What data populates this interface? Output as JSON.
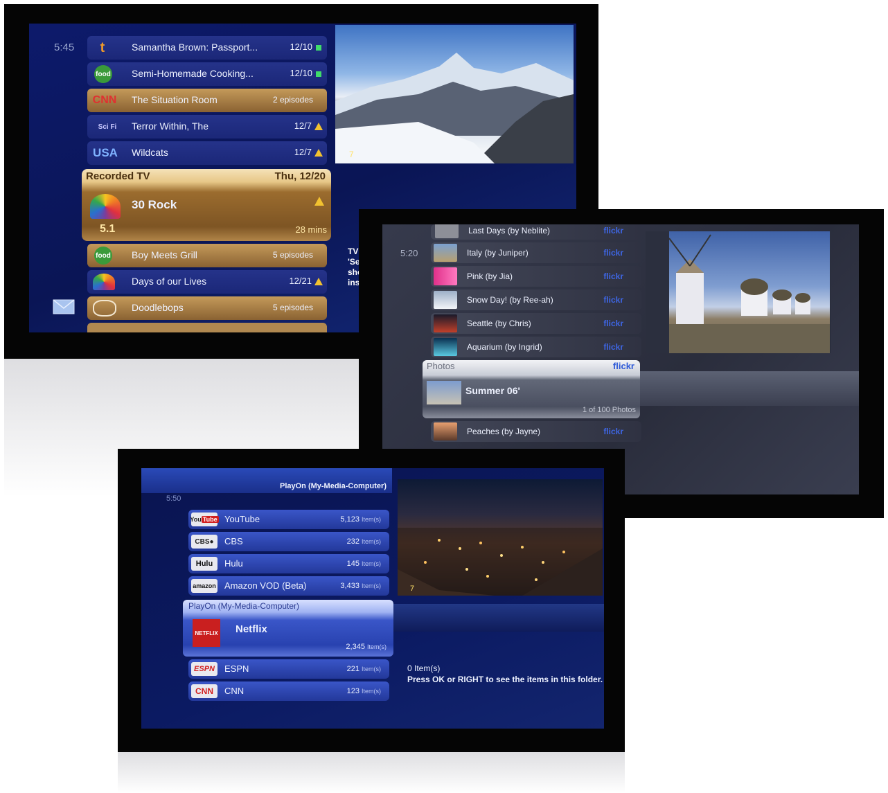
{
  "tv1": {
    "time": "5:45",
    "rows": [
      {
        "channel": "tlc",
        "title": "Samantha Brown: Passport...",
        "info": "12/10",
        "status": "new"
      },
      {
        "channel": "food",
        "title": "Semi-Homemade Cooking...",
        "info": "12/10",
        "status": "new"
      },
      {
        "channel": "CNN",
        "title": "The Situation Room",
        "info": "2 episodes",
        "status": ""
      },
      {
        "channel": "Sci Fi",
        "title": "Terror Within, The",
        "info": "12/7",
        "status": "warning"
      },
      {
        "channel": "USA",
        "title": "Wildcats",
        "info": "12/7",
        "status": "warning"
      }
    ],
    "section": "Recorded TV",
    "date": "Thu, 12/20",
    "selected": {
      "title": "30 Rock",
      "channel_number": "5.1",
      "duration": "28 mins",
      "status": "warning"
    },
    "rows_below": [
      {
        "channel": "food",
        "title": "Boy Meets Grill",
        "info": "5 episodes",
        "status": ""
      },
      {
        "channel": "NBC",
        "title": "Days of our Lives",
        "info": "12/21",
        "status": "warning"
      },
      {
        "channel": "Doodlebops",
        "title": "Doodlebops",
        "info": "5 episodes",
        "status": ""
      }
    ],
    "side_text": [
      "TV",
      "'Se",
      "sho",
      "ins"
    ],
    "preview_channel": "7"
  },
  "tv2": {
    "time": "5:20",
    "rows": [
      {
        "title": "Last Days (by Neblite)",
        "source": "flickr"
      },
      {
        "title": "Italy (by Juniper)",
        "source": "flickr"
      },
      {
        "title": "Pink (by Jia)",
        "source": "flickr"
      },
      {
        "title": "Snow Day! (by Ree-ah)",
        "source": "flickr"
      },
      {
        "title": "Seattle (by Chris)",
        "source": "flickr"
      },
      {
        "title": "Aquarium (by Ingrid)",
        "source": "flickr"
      }
    ],
    "section": "Photos",
    "section_source": "flickr",
    "selected": {
      "title": "Summer 06'",
      "count": "1 of 100 Photos"
    },
    "rows_below": [
      {
        "title": "Peaches (by Jayne)",
        "source": "flickr"
      }
    ]
  },
  "tv3": {
    "header": "PlayOn (My-Media-Computer)",
    "time": "5:50",
    "rows": [
      {
        "logo": "YouTube",
        "title": "YouTube",
        "count": "5,123",
        "unit": "Item(s)"
      },
      {
        "logo": "CBS",
        "title": "CBS",
        "count": "232",
        "unit": "Item(s)"
      },
      {
        "logo": "Hulu",
        "title": "Hulu",
        "count": "145",
        "unit": "Item(s)"
      },
      {
        "logo": "amazon",
        "title": "Amazon VOD (Beta)",
        "count": "3,433",
        "unit": "Item(s)"
      }
    ],
    "section": "PlayOn (My-Media-Computer)",
    "selected": {
      "logo": "NETFLIX",
      "title": "Netflix",
      "count": "2,345",
      "unit": "Item(s)"
    },
    "rows_below": [
      {
        "logo": "ESPN",
        "title": "ESPN",
        "count": "221",
        "unit": "Item(s)"
      },
      {
        "logo": "CNN",
        "title": "CNN",
        "count": "123",
        "unit": "Item(s)"
      }
    ],
    "info_count": "0 Item(s)",
    "info_hint": "Press OK or RIGHT to see the items in this folder.",
    "preview_channel": "7"
  }
}
